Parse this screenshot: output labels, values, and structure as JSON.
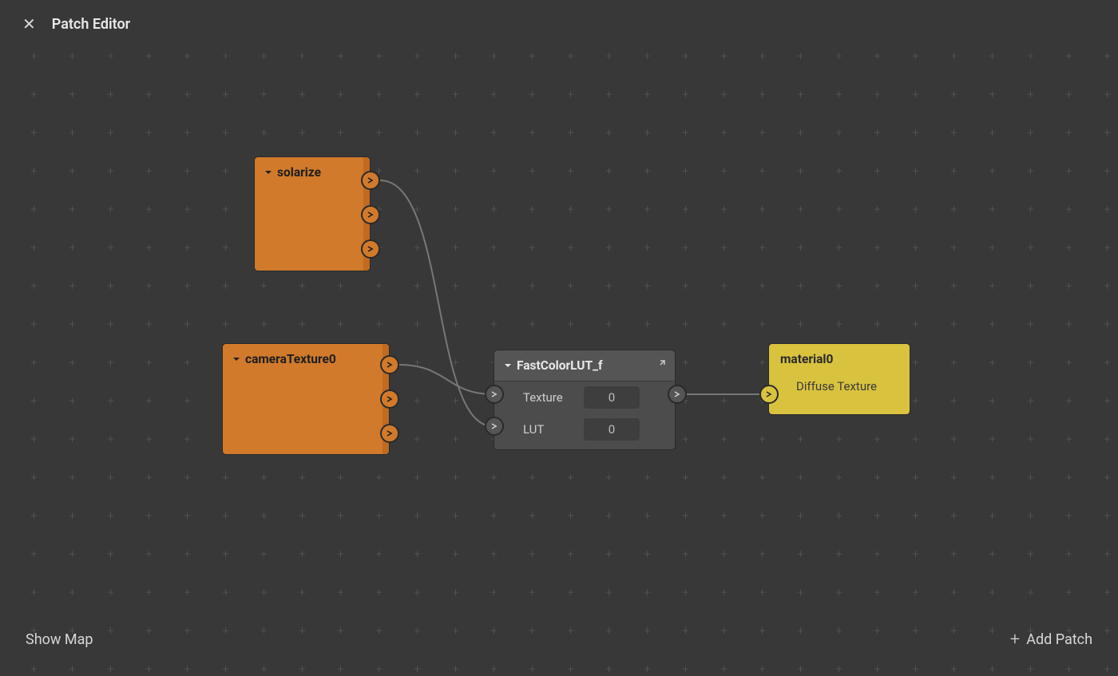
{
  "header": {
    "title": "Patch Editor"
  },
  "footer": {
    "showMap": "Show Map",
    "addPatch": "Add Patch"
  },
  "nodes": {
    "solarize": {
      "title": "solarize"
    },
    "camera": {
      "title": "cameraTexture0"
    },
    "fastlut": {
      "title": "FastColorLUT_f",
      "rows": [
        {
          "label": "Texture",
          "value": "0"
        },
        {
          "label": "LUT",
          "value": "0"
        }
      ]
    },
    "material": {
      "title": "material0",
      "sub": "Diffuse Texture"
    }
  }
}
